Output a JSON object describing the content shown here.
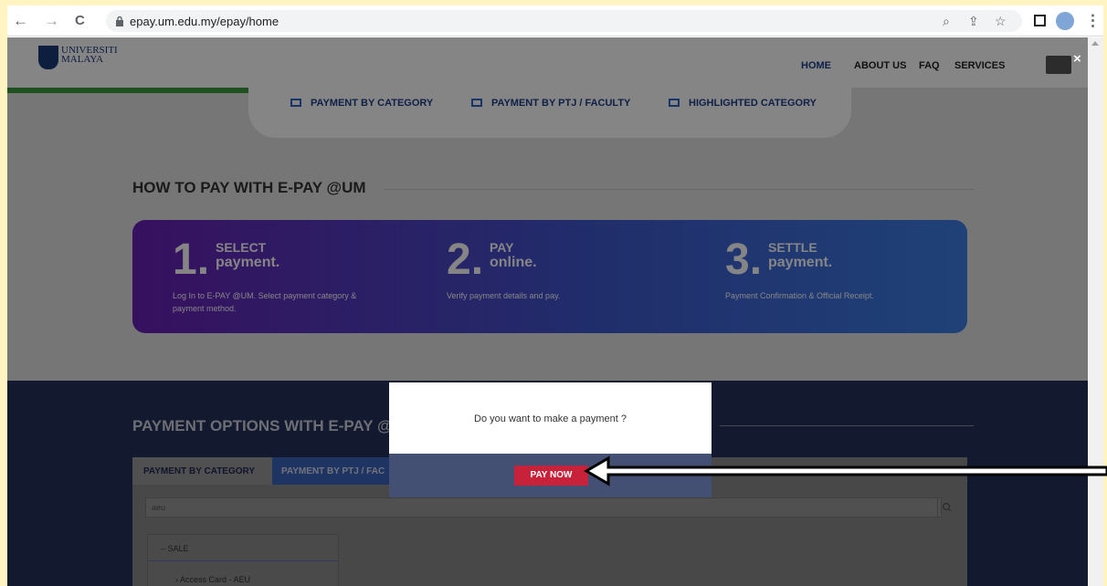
{
  "browser": {
    "back": "←",
    "forward": "→",
    "reload": "C",
    "url": "epay.um.edu.my/epay/home"
  },
  "site": {
    "logo_text_1": "UNIVERSITI",
    "logo_text_2": "MALAYA",
    "nav": [
      "HOME",
      "ABOUT US",
      "FAQ",
      "SERVICES"
    ],
    "close": "×"
  },
  "category_tabs": [
    "PAYMENT BY CATEGORY",
    "PAYMENT BY PTJ / FACULTY",
    "HIGHLIGHTED CATEGORY"
  ],
  "howto": {
    "title": "HOW TO PAY WITH E-PAY @UM",
    "steps": [
      {
        "num": "1.",
        "line1": "SELECT",
        "line2": "payment.",
        "desc": "Log In to E-PAY @UM. Select payment category & payment method."
      },
      {
        "num": "2.",
        "line1": "PAY",
        "line2": "online.",
        "desc": "Verify payment details and pay."
      },
      {
        "num": "3.",
        "line1": "SETTLE",
        "line2": "payment.",
        "desc": "Payment Confirmation & Official Receipt."
      }
    ]
  },
  "options": {
    "title": "PAYMENT OPTIONS WITH E-PAY @",
    "tab1": "PAYMENT BY CATEGORY",
    "tab2": "PAYMENT BY PTJ / FAC",
    "search_value": "aeu",
    "tree_group": "– SALE",
    "tree_item": "› Access Card - AEU"
  },
  "modal": {
    "message": "Do you want to make a payment ?",
    "button": "PAY NOW"
  },
  "colors": {
    "accent": "#1e3f8a",
    "pay_button": "#c8223a",
    "annotation_bg": "#fff4c2"
  }
}
